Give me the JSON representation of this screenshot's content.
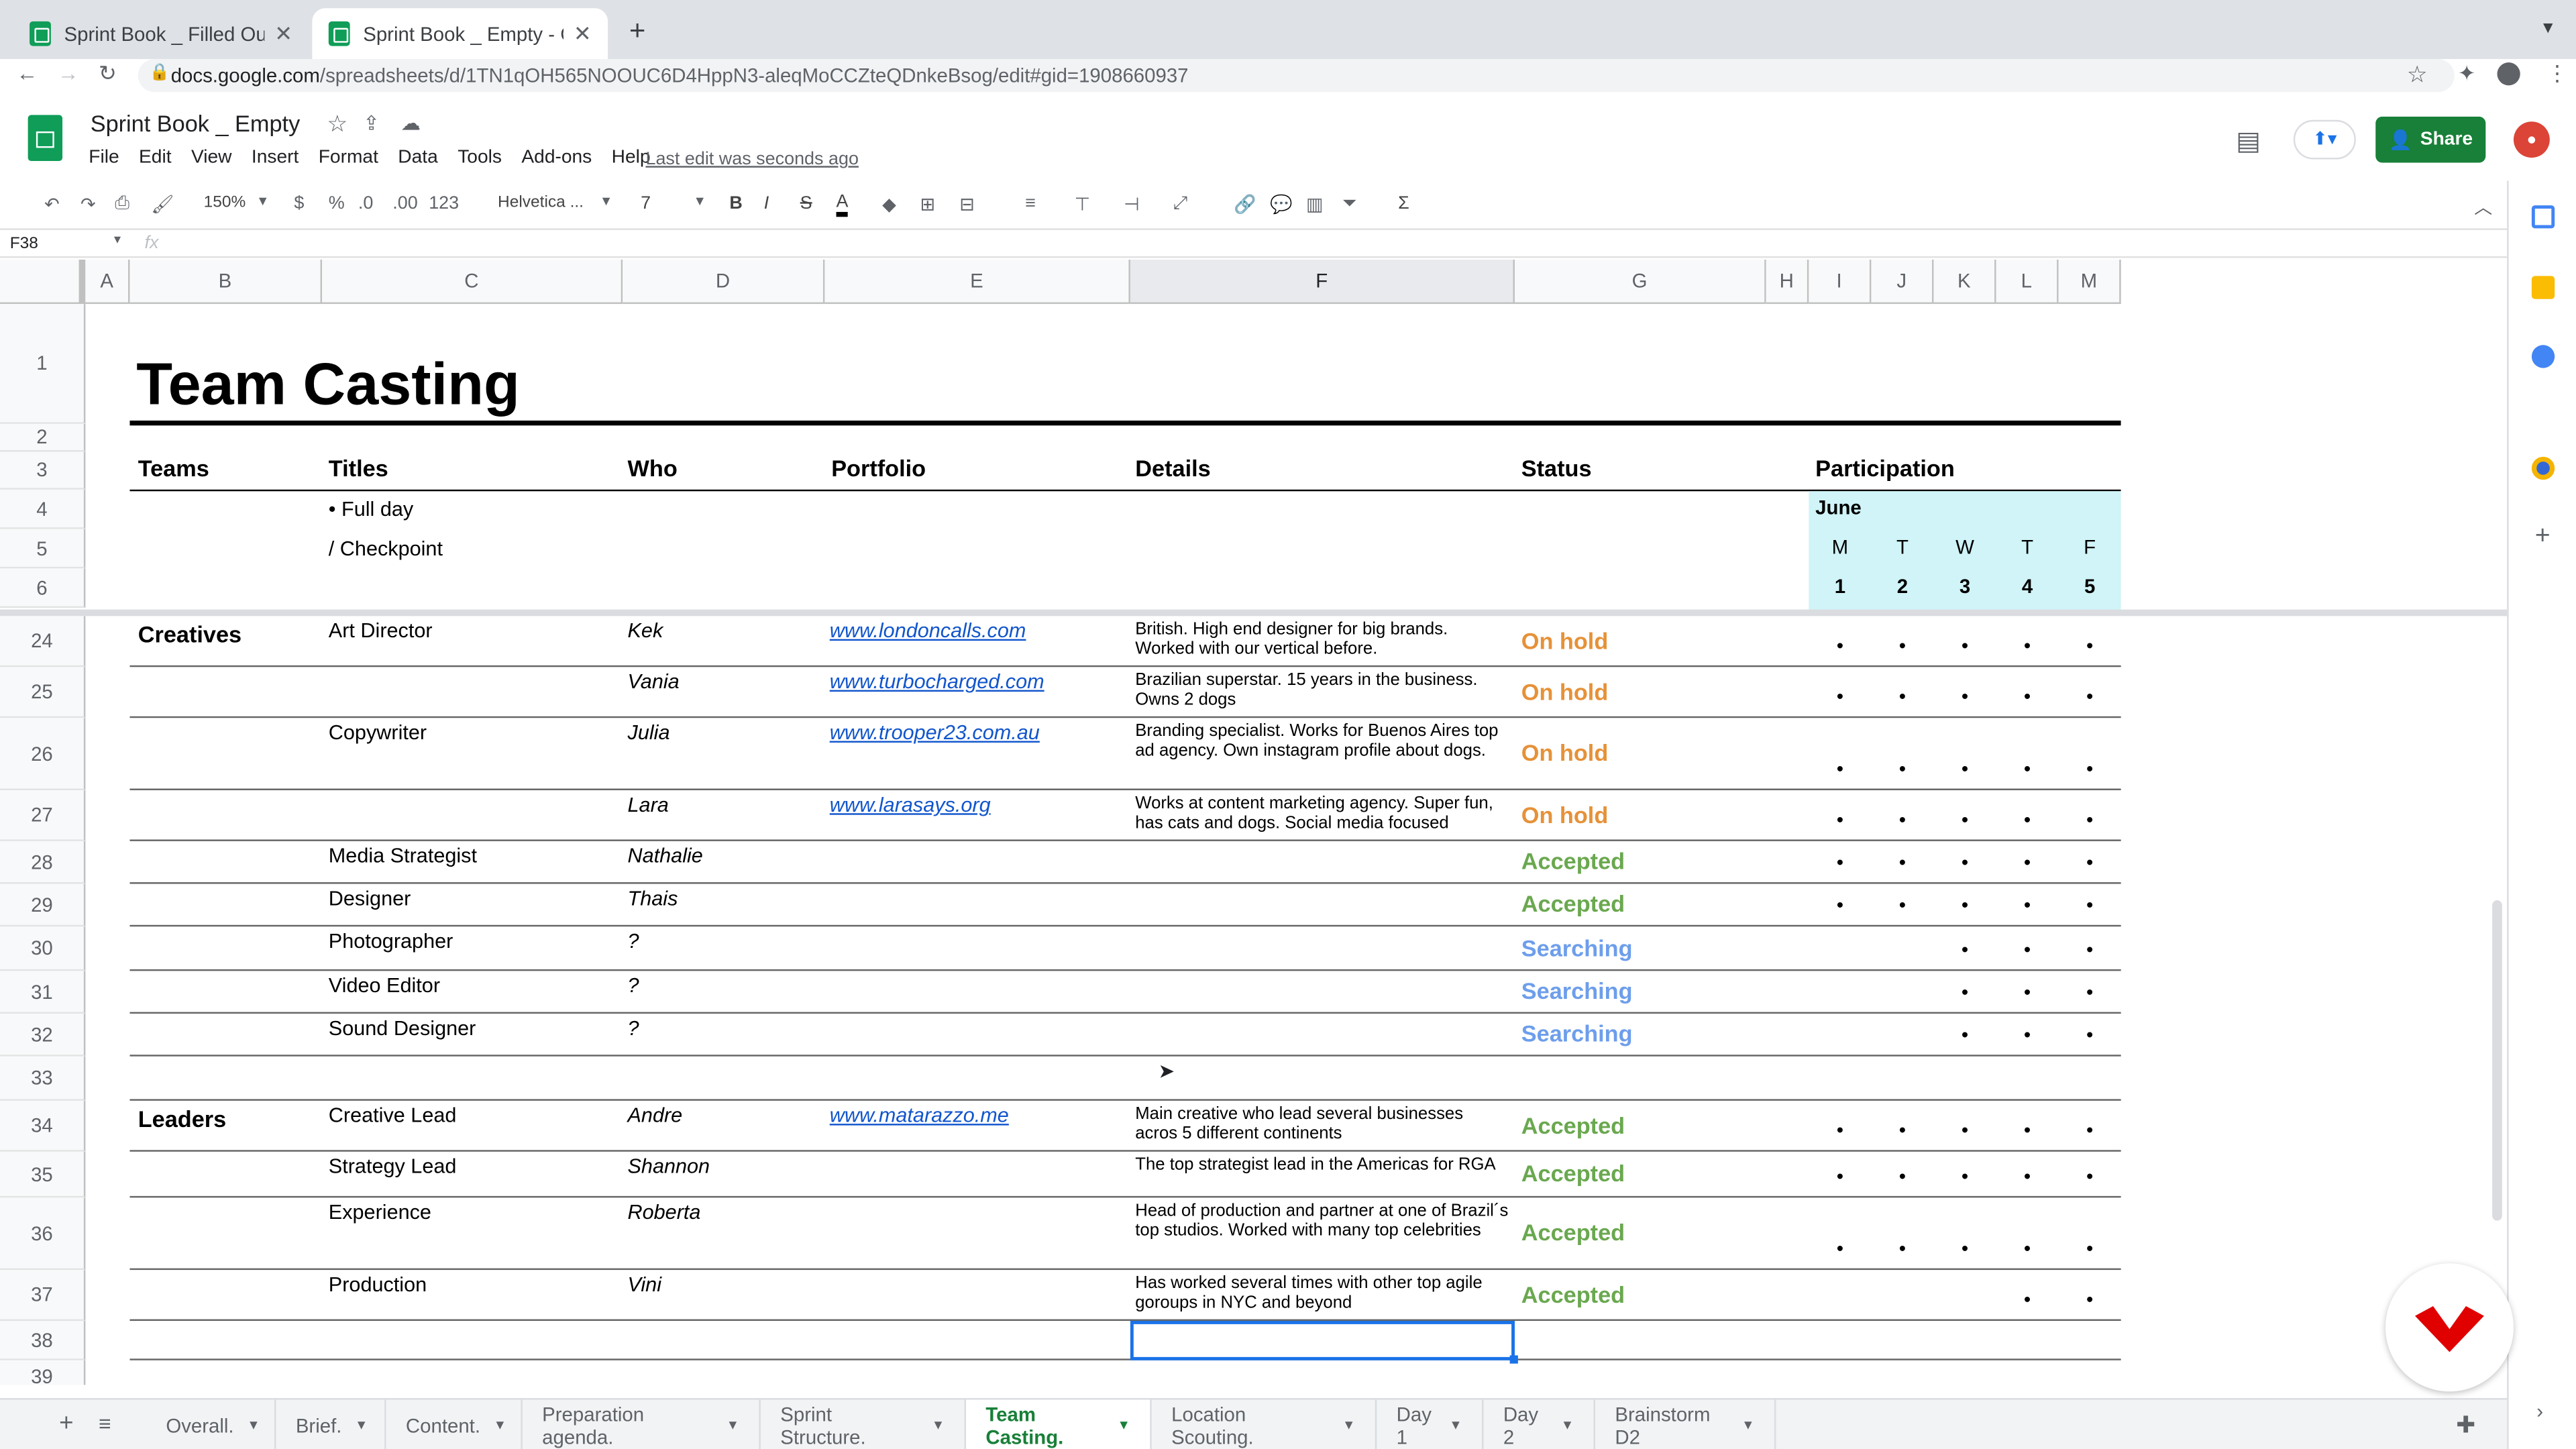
{
  "browser": {
    "tabs": [
      {
        "title": "Sprint Book _ Filled Out - Goog",
        "active": false
      },
      {
        "title": "Sprint Book _ Empty - Google S",
        "active": true
      }
    ],
    "new_tab": "+",
    "url_host": "docs.google.com",
    "url_path": "/spreadsheets/d/1TN1qOH565NOOUC6D4HppN3-aleqMoCCZteQDnkeBsog/edit#gid=1908660937"
  },
  "doc": {
    "title": "Sprint Book _ Empty",
    "menus": [
      "File",
      "Edit",
      "View",
      "Insert",
      "Format",
      "Data",
      "Tools",
      "Add-ons",
      "Help"
    ],
    "last_edit": "Last edit was seconds ago",
    "share": "Share"
  },
  "toolbar": {
    "zoom": "150%",
    "currency": "$",
    "percent": "%",
    "dec_less": ".0",
    "dec_more": ".00",
    "format_more": "123",
    "font": "Helvetica ...",
    "size": "7",
    "bold": "B",
    "italic": "I",
    "strike": "S",
    "textcolor": "A",
    "sum": "Σ"
  },
  "formula": {
    "name_box": "F38",
    "fx": "fx"
  },
  "columns": [
    "A",
    "B",
    "C",
    "D",
    "E",
    "F",
    "G",
    "H",
    "I",
    "J",
    "K",
    "L",
    "M"
  ],
  "sheet": {
    "title": "Team Casting",
    "headers": {
      "teams": "Teams",
      "titles": "Titles",
      "who": "Who",
      "portfolio": "Portfolio",
      "details": "Details",
      "status": "Status",
      "participation": "Participation"
    },
    "legend": [
      {
        "label": "• Full day"
      },
      {
        "label": "/ Checkpoint"
      }
    ],
    "month": "June",
    "days": [
      "M",
      "T",
      "W",
      "T",
      "F"
    ],
    "dates": [
      "1",
      "2",
      "3",
      "4",
      "5"
    ],
    "frozen_rows": [
      "1",
      "2",
      "3",
      "4",
      "5",
      "6"
    ],
    "rows": [
      {
        "num": "24",
        "team": "Creatives",
        "title": "Art Director",
        "who": "Kek",
        "portfolio": "www.londoncalls.com",
        "details": "British. High end designer for big brands. Worked with our vertical before.",
        "status": "On hold",
        "status_color": "#e69138",
        "participation": [
          "•",
          "•",
          "•",
          "•",
          "•"
        ]
      },
      {
        "num": "25",
        "team": "",
        "title": "",
        "who": "Vania",
        "portfolio": "www.turbocharged.com",
        "details": "Brazilian superstar. 15 years in the business. Owns 2 dogs",
        "status": "On hold",
        "status_color": "#e69138",
        "participation": [
          "•",
          "•",
          "•",
          "•",
          "•"
        ]
      },
      {
        "num": "26",
        "team": "",
        "title": "Copywriter",
        "who": "Julia",
        "portfolio": "www.trooper23.com.au",
        "details": "Branding specialist. Works for Buenos Aires top ad agency. Own instagram profile about dogs.",
        "status": "On hold",
        "status_color": "#e69138",
        "participation": [
          "•",
          "•",
          "•",
          "•",
          "•"
        ]
      },
      {
        "num": "27",
        "team": "",
        "title": "",
        "who": "Lara",
        "portfolio": "www.larasays.org",
        "details": "Works at content marketing agency. Super fun, has cats and dogs. Social media focused",
        "status": "On hold",
        "status_color": "#e69138",
        "participation": [
          "•",
          "•",
          "•",
          "•",
          "•"
        ]
      },
      {
        "num": "28",
        "team": "",
        "title": "Media Strategist",
        "who": "Nathalie",
        "portfolio": "",
        "details": "",
        "status": "Accepted",
        "status_color": "#6aa84f",
        "participation": [
          "•",
          "•",
          "•",
          "•",
          "•"
        ]
      },
      {
        "num": "29",
        "team": "",
        "title": "Designer",
        "who": "Thais",
        "portfolio": "",
        "details": "",
        "status": "Accepted",
        "status_color": "#6aa84f",
        "participation": [
          "•",
          "•",
          "•",
          "•",
          "•"
        ]
      },
      {
        "num": "30",
        "team": "",
        "title": "Photographer",
        "who": "?",
        "portfolio": "",
        "details": "",
        "status": "Searching",
        "status_color": "#6d9eeb",
        "participation": [
          "",
          "",
          "•",
          "•",
          "•"
        ]
      },
      {
        "num": "31",
        "team": "",
        "title": "Video Editor",
        "who": "?",
        "portfolio": "",
        "details": "",
        "status": "Searching",
        "status_color": "#6d9eeb",
        "participation": [
          "",
          "",
          "•",
          "•",
          "•"
        ]
      },
      {
        "num": "32",
        "team": "",
        "title": "Sound Designer",
        "who": "?",
        "portfolio": "",
        "details": "",
        "status": "Searching",
        "status_color": "#6d9eeb",
        "participation": [
          "",
          "",
          "•",
          "•",
          "•"
        ]
      },
      {
        "num": "33",
        "team": "",
        "title": "",
        "who": "",
        "portfolio": "",
        "details": "",
        "status": "",
        "status_color": "#000000",
        "participation": [
          "",
          "",
          "",
          "",
          ""
        ]
      },
      {
        "num": "34",
        "team": "Leaders",
        "title": "Creative Lead",
        "who": "Andre",
        "portfolio": "www.matarazzo.me",
        "details": "Main creative who lead several businesses acros 5 different continents",
        "status": "Accepted",
        "status_color": "#6aa84f",
        "participation": [
          "•",
          "•",
          "•",
          "•",
          "•"
        ]
      },
      {
        "num": "35",
        "team": "",
        "title": "Strategy Lead",
        "who": "Shannon",
        "portfolio": "",
        "details": "The top strategist lead in the Americas for RGA",
        "status": "Accepted",
        "status_color": "#6aa84f",
        "participation": [
          "•",
          "•",
          "•",
          "•",
          "•"
        ]
      },
      {
        "num": "36",
        "team": "",
        "title": "Experience",
        "who": "Roberta",
        "portfolio": "",
        "details": "Head of production and partner at one of Brazil´s top studios. Worked with many top celebrities",
        "status": "Accepted",
        "status_color": "#6aa84f",
        "participation": [
          "•",
          "•",
          "•",
          "•",
          "•"
        ]
      },
      {
        "num": "37",
        "team": "",
        "title": "Production",
        "who": "Vini",
        "portfolio": "",
        "details": "Has worked several times with other top agile goroups in NYC and beyond",
        "status": "Accepted",
        "status_color": "#6aa84f",
        "participation": [
          "",
          "",
          "",
          "•",
          "•"
        ]
      },
      {
        "num": "38",
        "team": "",
        "title": "",
        "who": "",
        "portfolio": "",
        "details": "",
        "status": "",
        "status_color": "#000000",
        "participation": [
          "",
          "",
          "",
          "",
          ""
        ]
      },
      {
        "num": "39",
        "team": "",
        "title": "",
        "who": "",
        "portfolio": "",
        "details": "",
        "status": "",
        "status_color": "#000000",
        "participation": [
          "",
          "",
          "",
          "",
          ""
        ]
      }
    ]
  },
  "sheet_tabs": [
    "Overall.",
    "Brief.",
    "Content.",
    "Preparation agenda.",
    "Sprint Structure.",
    "Team Casting.",
    "Location Scouting.",
    "Day 1",
    "Day 2",
    "Brainstorm D2"
  ],
  "active_sheet": "Team Casting.",
  "colors": {
    "accent_green": "#188038",
    "participation_bg": "#d0f4f8",
    "selection": "#1a73e8"
  }
}
